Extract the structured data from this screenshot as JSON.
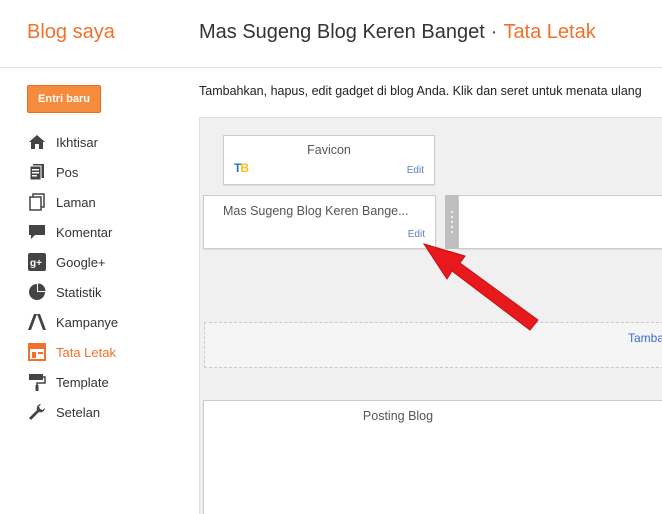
{
  "header": {
    "brand": "Blog saya",
    "blog_title": "Mas Sugeng Blog Keren Banget",
    "separator": "·",
    "section": "Tata Letak"
  },
  "sidebar": {
    "new_post_label": "Entri baru",
    "items": [
      {
        "label": "Ikhtisar",
        "icon": "home-icon"
      },
      {
        "label": "Pos",
        "icon": "posts-icon"
      },
      {
        "label": "Laman",
        "icon": "pages-icon"
      },
      {
        "label": "Komentar",
        "icon": "comment-icon"
      },
      {
        "label": "Google+",
        "icon": "google-plus-icon"
      },
      {
        "label": "Statistik",
        "icon": "pie-chart-icon"
      },
      {
        "label": "Kampanye",
        "icon": "adwords-icon"
      },
      {
        "label": "Tata Letak",
        "icon": "layout-icon",
        "active": true
      },
      {
        "label": "Template",
        "icon": "paint-roller-icon"
      },
      {
        "label": "Setelan",
        "icon": "wrench-icon"
      }
    ]
  },
  "main": {
    "description": "Tambahkan, hapus, edit gadget di blog Anda. Klik dan seret untuk menata ulang",
    "gadgets": {
      "favicon": {
        "title": "Favicon",
        "logo_t": "T",
        "logo_b": "B",
        "edit": "Edit"
      },
      "header": {
        "title": "Mas Sugeng Blog Keren Bange...",
        "edit": "Edit"
      },
      "add_gadget": "Tamba",
      "posting": {
        "title": "Posting Blog"
      }
    }
  },
  "colors": {
    "accent": "#f1712b",
    "button": "#f58b3c",
    "link": "#5b7fbf",
    "arrow": "#e8191c"
  }
}
